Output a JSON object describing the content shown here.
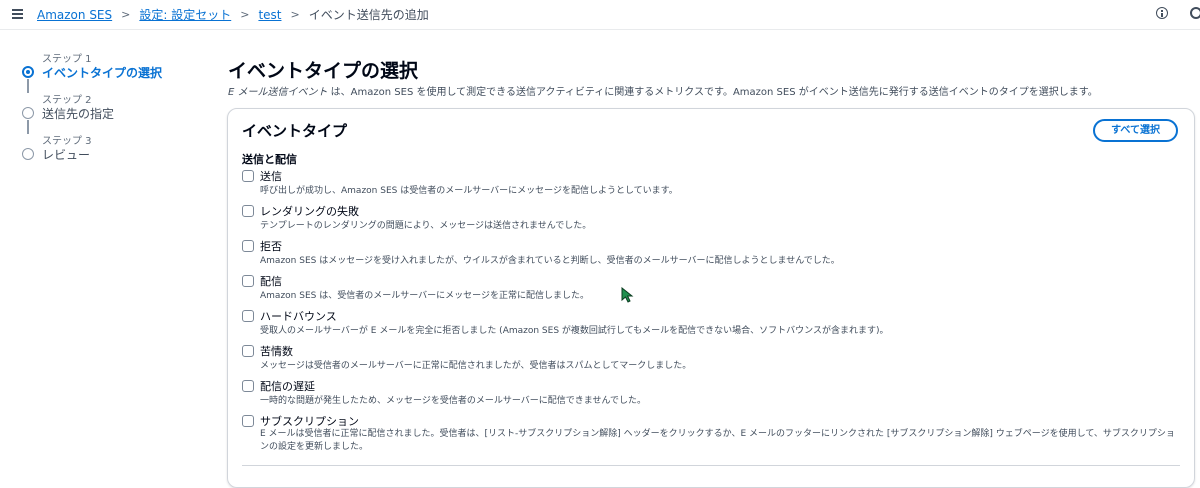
{
  "breadcrumb": {
    "items": [
      "Amazon SES",
      "設定: 設定セット",
      "test"
    ],
    "separator": ">",
    "current": "イベント送信先の追加"
  },
  "steps": [
    {
      "num": "ステップ 1",
      "title": "イベントタイプの選択",
      "active": true
    },
    {
      "num": "ステップ 2",
      "title": "送信先の指定",
      "active": false
    },
    {
      "num": "ステップ 3",
      "title": "レビュー",
      "active": false
    }
  ],
  "page": {
    "title": "イベントタイプの選択",
    "desc_em": "E メール送信イベント",
    "desc_rest": " は、Amazon SES を使用して測定できる送信アクティビティに関連するメトリクスです。Amazon SES がイベント送信先に発行する送信イベントのタイプを選択します。"
  },
  "container": {
    "title": "イベントタイプ",
    "select_all_label": "すべて選択",
    "group_label": "送信と配信",
    "options": [
      {
        "label": "送信",
        "desc": "呼び出しが成功し、Amazon SES は受信者のメールサーバーにメッセージを配信しようとしています。",
        "checked": false
      },
      {
        "label": "レンダリングの失敗",
        "desc": "テンプレートのレンダリングの問題により、メッセージは送信されませんでした。",
        "checked": false
      },
      {
        "label": "拒否",
        "desc": "Amazon SES はメッセージを受け入れましたが、ウイルスが含まれていると判断し、受信者のメールサーバーに配信しようとしませんでした。",
        "checked": false
      },
      {
        "label": "配信",
        "desc": "Amazon SES は、受信者のメールサーバーにメッセージを正常に配信しました。",
        "checked": false
      },
      {
        "label": "ハードバウンス",
        "desc": "受取人のメールサーバーが E メールを完全に拒否しました (Amazon SES が複数回試行してもメールを配信できない場合、ソフトバウンスが含まれます)。",
        "checked": false
      },
      {
        "label": "苦情数",
        "desc": "メッセージは受信者のメールサーバーに正常に配信されましたが、受信者はスパムとしてマークしました。",
        "checked": false
      },
      {
        "label": "配信の遅延",
        "desc": "一時的な問題が発生したため、メッセージを受信者のメールサーバーに配信できませんでした。",
        "checked": false
      },
      {
        "label": "サブスクリプション",
        "desc": "E メールは受信者に正常に配信されました。受信者は、[リスト-サブスクリプション解除] ヘッダーをクリックするか、E メールのフッターにリンクされた [サブスクリプション解除] ウェブページを使用して、サブスクリプションの設定を更新しました。",
        "checked": false
      }
    ]
  },
  "icons": {
    "menu": "hamburger-menu-icon",
    "info": "info-icon",
    "settings": "settings-icon",
    "cursor": "mouse-cursor-icon"
  },
  "colors": {
    "accent": "#0972d3",
    "text": "#000716",
    "muted": "#414d5c",
    "border": "#d1d5db",
    "cursor": "#1f8f4e"
  }
}
